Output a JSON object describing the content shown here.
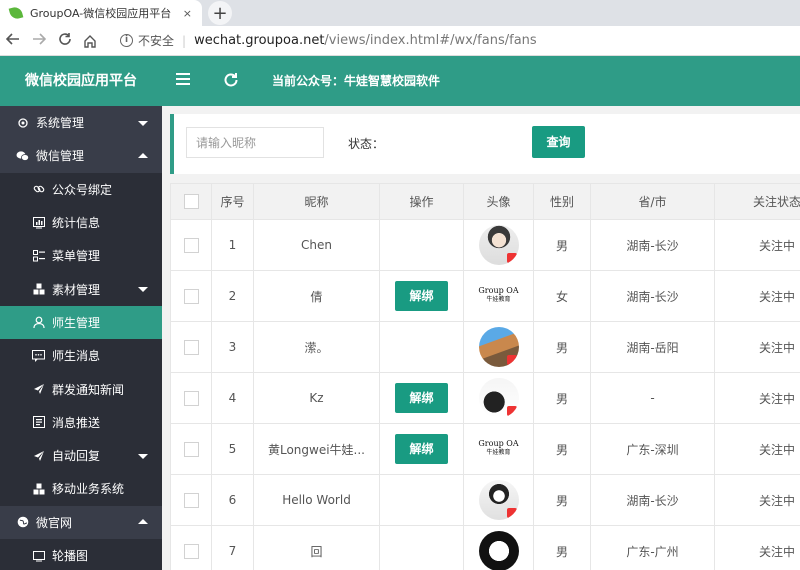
{
  "browser": {
    "tab_title": "GroupOA-微信校园应用平台",
    "tab_close": "×",
    "new_tab": "+",
    "security_label": "不安全",
    "url_host": "wechat.groupoa.net",
    "url_path": "/views/index.html#/wx/fans/fans"
  },
  "header": {
    "brand": "微信校园应用平台",
    "account_label": "当前公众号：牛娃智慧校园软件"
  },
  "sidebar": {
    "items": [
      {
        "label": "系统管理",
        "icon": "gear-icon",
        "kind": "group",
        "caret": "down"
      },
      {
        "label": "微信管理",
        "icon": "wechat-icon",
        "kind": "group",
        "caret": "up"
      },
      {
        "label": "公众号绑定",
        "icon": "link-icon",
        "kind": "child"
      },
      {
        "label": "统计信息",
        "icon": "chart-icon",
        "kind": "child"
      },
      {
        "label": "菜单管理",
        "icon": "menu-list-icon",
        "kind": "child"
      },
      {
        "label": "素材管理",
        "icon": "cubes-icon",
        "kind": "child",
        "caret": "down"
      },
      {
        "label": "师生管理",
        "icon": "user-icon",
        "kind": "child",
        "active": true
      },
      {
        "label": "师生消息",
        "icon": "message-icon",
        "kind": "child"
      },
      {
        "label": "群发通知新闻",
        "icon": "send-icon",
        "kind": "child"
      },
      {
        "label": "消息推送",
        "icon": "push-icon",
        "kind": "child"
      },
      {
        "label": "自动回复",
        "icon": "send-icon",
        "kind": "child",
        "caret": "down"
      },
      {
        "label": "移动业务系统",
        "icon": "cubes-icon",
        "kind": "child"
      },
      {
        "label": "微官网",
        "icon": "globe-icon",
        "kind": "group",
        "caret": "up"
      },
      {
        "label": "轮播图",
        "icon": "slideshow-icon",
        "kind": "child"
      }
    ]
  },
  "search": {
    "placeholder": "请输入昵称",
    "status_label": "状态：",
    "query_button": "查询"
  },
  "table": {
    "columns": [
      "序号",
      "昵称",
      "操作",
      "头像",
      "性别",
      "省/市",
      "关注状态"
    ],
    "action_label": "解绑",
    "rows": [
      {
        "index": "1",
        "nickname": "Chen",
        "has_action": false,
        "avatar": "avatar-person",
        "gender": "男",
        "region": "湖南-长沙",
        "status": "关注中"
      },
      {
        "index": "2",
        "nickname": "倩",
        "has_action": true,
        "avatar": "avatar-logo",
        "gender": "女",
        "region": "湖南-长沙",
        "status": "关注中"
      },
      {
        "index": "3",
        "nickname": "潆。",
        "has_action": false,
        "avatar": "avatar-scene",
        "gender": "男",
        "region": "湖南-岳阳",
        "status": "关注中"
      },
      {
        "index": "4",
        "nickname": "Kz",
        "has_action": true,
        "avatar": "avatar-cat",
        "gender": "男",
        "region": "-",
        "status": "关注中"
      },
      {
        "index": "5",
        "nickname": "黄Longwei牛娃...",
        "has_action": true,
        "avatar": "avatar-logo",
        "gender": "男",
        "region": "广东-深圳",
        "status": "关注中"
      },
      {
        "index": "6",
        "nickname": "Hello World",
        "has_action": false,
        "avatar": "avatar-anime",
        "gender": "男",
        "region": "湖南-长沙",
        "status": "关注中"
      },
      {
        "index": "7",
        "nickname": "回",
        "has_action": false,
        "avatar": "avatar-ring",
        "gender": "男",
        "region": "广东-广州",
        "status": "关注中"
      }
    ],
    "logo_text": "Group OA",
    "logo_sub": "牛娃教育"
  },
  "colors": {
    "accent": "#2f9c87",
    "button": "#199b82",
    "sidebar_bg": "#393d49",
    "sidebar_child_bg": "#2b2e37"
  }
}
